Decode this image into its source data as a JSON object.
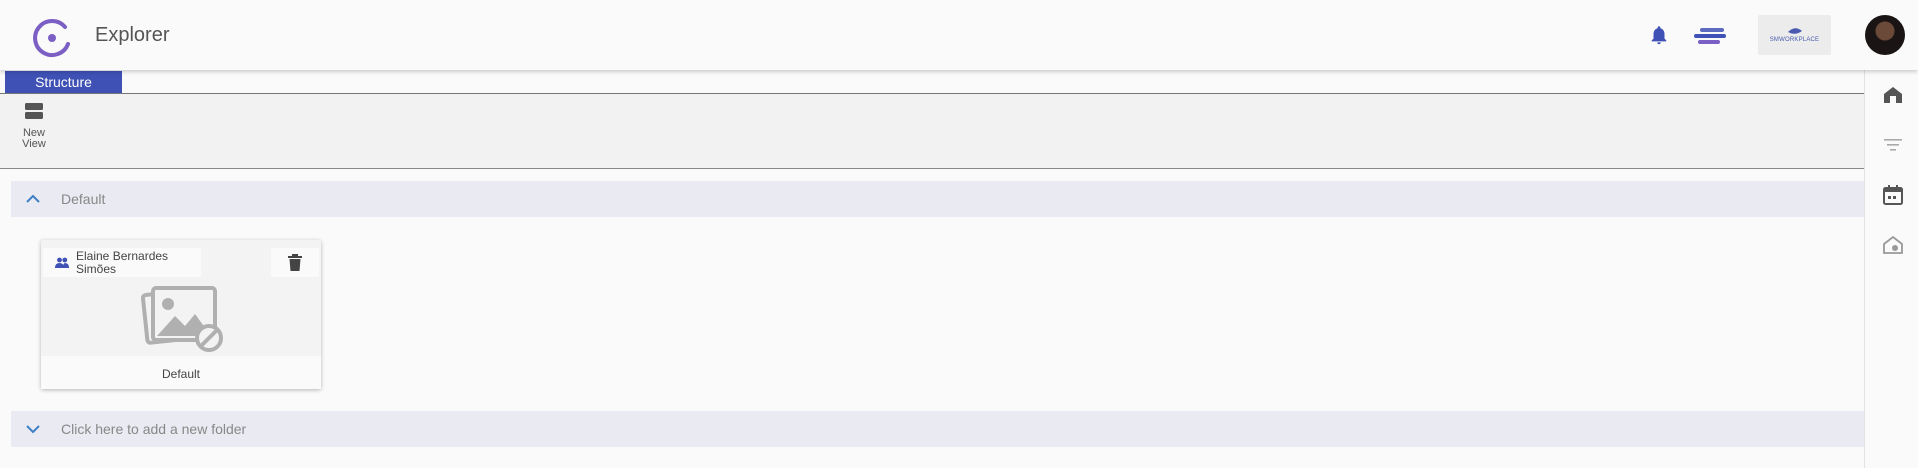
{
  "header": {
    "title": "Explorer",
    "brand_text": "SMWORKPLACE",
    "icons": [
      "app-logo-icon",
      "bell-icon",
      "stack-icon",
      "avatar"
    ]
  },
  "tabs": [
    {
      "label": "Structure",
      "active": true
    }
  ],
  "toolbar": {
    "new_view_label": "New\nView"
  },
  "sections": [
    {
      "label": "Default",
      "expanded": true
    },
    {
      "label": "Click here to add a new folder",
      "expanded": false
    }
  ],
  "card": {
    "owner": "Elaine Bernardes Simões",
    "name": "Default"
  },
  "sidebar": {
    "icons": [
      "home-icon",
      "filter-icon",
      "calendar-icon",
      "home-search-icon"
    ]
  },
  "colors": {
    "accent": "#3f51b5",
    "section_bg": "#e9eaf2",
    "logo": "#7b5fc4"
  }
}
